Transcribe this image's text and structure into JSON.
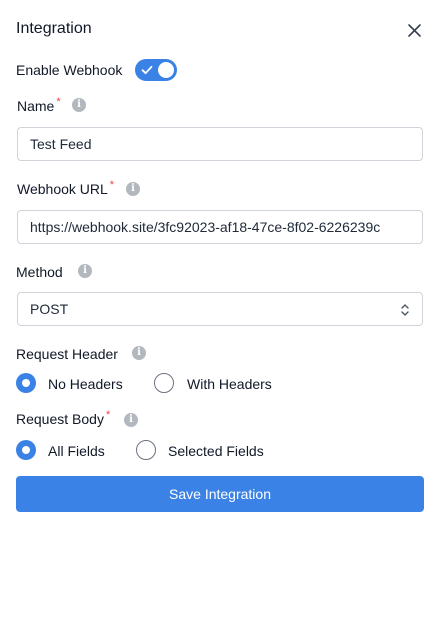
{
  "panel": {
    "title": "Integration",
    "close_icon": "close-icon"
  },
  "webhook_toggle": {
    "label": "Enable Webhook",
    "enabled": true,
    "color": "#3b82e6"
  },
  "name_field": {
    "label": "Name",
    "required_mark": "*",
    "value": "Test Feed"
  },
  "url_field": {
    "label": "Webhook URL",
    "required_mark": "*",
    "value": "https://webhook.site/3fc92023-af18-47ce-8f02-6226239c"
  },
  "method_field": {
    "label": "Method",
    "value": "POST"
  },
  "request_header": {
    "label": "Request Header",
    "options": [
      "No Headers",
      "With Headers"
    ],
    "selected": "No Headers"
  },
  "request_body": {
    "label": "Request Body",
    "required_mark": "*",
    "options": [
      "All Fields",
      "Selected Fields"
    ],
    "selected": "All Fields"
  },
  "save_button": {
    "label": "Save Integration",
    "color": "#3b82e6"
  },
  "colors": {
    "accent": "#3b82e6",
    "required": "#ef4444",
    "info_icon": "#b3b8bf"
  }
}
